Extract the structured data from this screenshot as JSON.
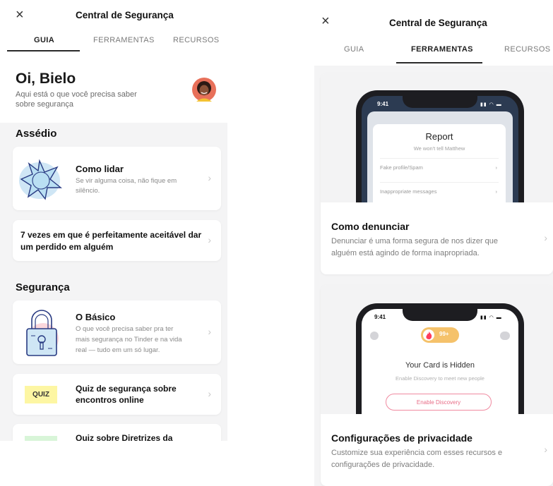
{
  "left": {
    "header": {
      "close_icon": "×",
      "title": "Central de Segurança"
    },
    "tabs": [
      {
        "label": "GUIA",
        "active": true
      },
      {
        "label": "FERRAMENTAS",
        "active": false
      },
      {
        "label": "RECURSOS",
        "active": false
      }
    ],
    "greeting": {
      "title": "Oi, Bielo",
      "subtitle_line1": "Aqui está o que você precisa saber",
      "subtitle_line2": "sobre segurança"
    },
    "sections": {
      "harassment": {
        "title": "Assédio",
        "card1": {
          "title": "Como lidar",
          "desc_line1": "Se vir alguma coisa, não fique em",
          "desc_line2": "silêncio."
        },
        "card2": {
          "title_line1": "7 vezes em que é perfeitamente aceitável dar",
          "title_line2": "um perdido em alguém"
        }
      },
      "safety": {
        "title": "Segurança",
        "card1": {
          "title": "O Básico",
          "desc_line1": "O que você precisa saber pra ter",
          "desc_line2": "mais segurança no Tinder e na vida",
          "desc_line3": "real — tudo em um só lugar."
        },
        "card2": {
          "tag": "QUIZ",
          "title_line1": "Quiz de segurança sobre",
          "title_line2": "encontros online"
        },
        "card3": {
          "title": "Quiz sobre Diretrizes da"
        }
      }
    },
    "chevron": "›"
  },
  "right": {
    "header": {
      "close_icon": "×",
      "title": "Central de Segurança"
    },
    "tabs": [
      {
        "label": "GUIA",
        "active": false
      },
      {
        "label": "FERRAMENTAS",
        "active": true
      },
      {
        "label": "RECURSOS",
        "active": false
      }
    ],
    "report_card": {
      "phone": {
        "time": "9:41",
        "status_icons": "▮▮ ◠ ▬",
        "modal_title": "Report",
        "modal_sub": "We won't tell Matthew",
        "row1": "Fake profile/Spam",
        "row2": "Inappropriate messages",
        "row_arrow": "›"
      },
      "title": "Como denunciar",
      "desc_line1": "Denunciar é uma forma segura de nos dizer que",
      "desc_line2": "alguém está agindo de forma inapropriada."
    },
    "privacy_card": {
      "phone": {
        "time": "9:41",
        "status_icons": "▮▮ ◠ ▬",
        "badge": "99+",
        "hidden_title": "Your Card is Hidden",
        "hidden_sub": "Enable Discovery to meet new people",
        "button": "Enable Discovery"
      },
      "title": "Configurações de privacidade",
      "desc_line1": "Customize sua experiência com esses recursos e",
      "desc_line2": "configurações de privacidade."
    },
    "chevron": "›"
  },
  "colors": {
    "background": "#f4f4f5",
    "card": "#ffffff",
    "quiz_tag": "#fdf6a3",
    "tinder_red": "#fe3c5c",
    "discovery_border": "#f08aa0"
  }
}
